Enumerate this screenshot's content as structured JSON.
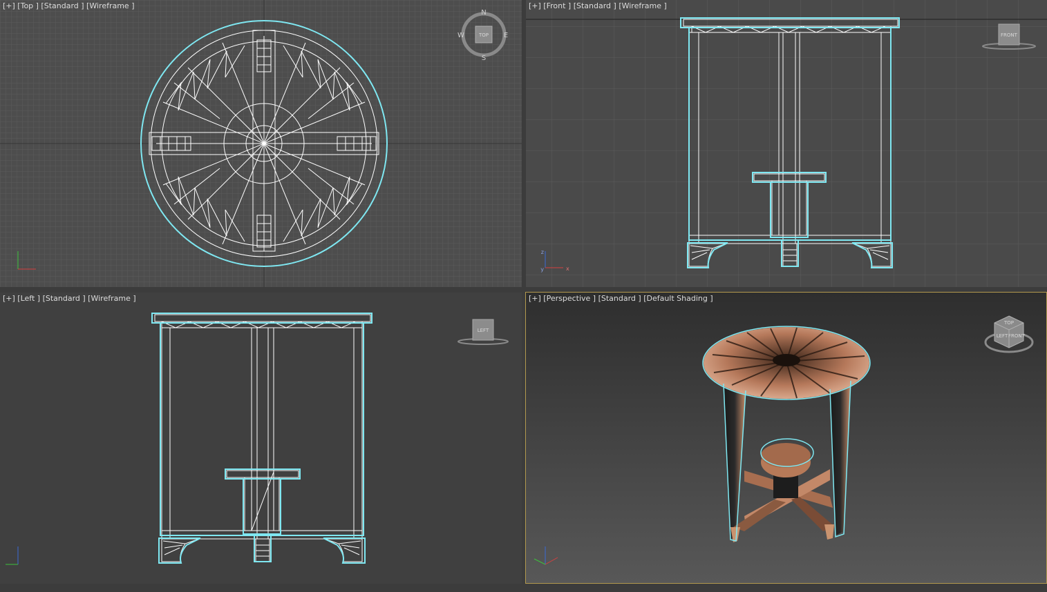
{
  "viewports": {
    "top": {
      "label": "[+] [Top ] [Standard ] [Wireframe ]",
      "compass": {
        "n": "N",
        "s": "S",
        "e": "E",
        "w": "W",
        "cube_face": "TOP"
      }
    },
    "front": {
      "label": "[+] [Front ] [Standard ] [Wireframe ]",
      "cube_face": "FRONT"
    },
    "left": {
      "label": "[+] [Left ] [Standard ] [Wireframe ]",
      "cube_face": "LEFT"
    },
    "perspective": {
      "label": "[+] [Perspective ] [Standard ] [Default Shading ]",
      "cube_faces": {
        "top": "TOP",
        "left": "LEFT",
        "front": "FRONT"
      }
    }
  },
  "axis_labels": {
    "x": "x",
    "y": "y",
    "z": "z"
  },
  "colors": {
    "viewport_bg": "#4a4a4a",
    "grid_line": "#5a5a5a",
    "wire_white": "#ffffff",
    "selection_cyan": "#7fe8f2",
    "wood": "#b77a58",
    "active_border": "#b39a4e"
  }
}
